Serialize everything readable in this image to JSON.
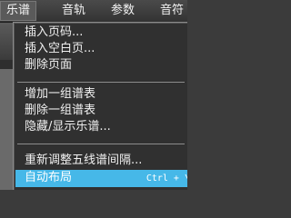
{
  "menubar": {
    "items": [
      {
        "label": "乐谱"
      },
      {
        "label": "音轨"
      },
      {
        "label": "参数"
      },
      {
        "label": "音符"
      }
    ]
  },
  "dropdown": {
    "groups": [
      [
        "插入页码...",
        "插入空白页...",
        "删除页面"
      ],
      [
        "增加一组谱表",
        "删除一组谱表",
        "隐藏/显示乐谱..."
      ],
      [
        "重新调整五线谱间隔...",
        "自动布局"
      ]
    ],
    "highlighted": "自动布局",
    "shortcut": "Ctrl + \\",
    "colors": {
      "highlight": "#46b8e8",
      "background": "#303030",
      "text": "#f0f0f0"
    }
  }
}
